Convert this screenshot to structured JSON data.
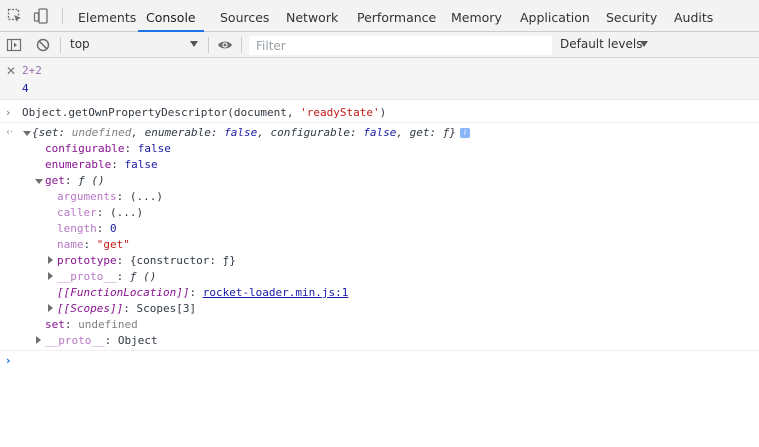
{
  "tabs": [
    {
      "label": "Elements"
    },
    {
      "label": "Console",
      "active": true
    },
    {
      "label": "Sources"
    },
    {
      "label": "Network"
    },
    {
      "label": "Performance"
    },
    {
      "label": "Memory"
    },
    {
      "label": "Application"
    },
    {
      "label": "Security"
    },
    {
      "label": "Audits"
    }
  ],
  "toolbar": {
    "context": "top",
    "filter_placeholder": "Filter",
    "levels": "Default levels"
  },
  "eager_eval": {
    "input": "2+2",
    "result": "4"
  },
  "command": {
    "prefix": "Object.getOwnPropertyDescriptor(document, ",
    "arg": "'readyState'",
    "suffix": ")"
  },
  "result": {
    "summary_open": "{",
    "summary_set_k": "set",
    "summary_set_v": "undefined",
    "summary_enum_k": "enumerable",
    "summary_enum_v": "false",
    "summary_conf_k": "configurable",
    "summary_conf_v": "false",
    "summary_get_k": "get",
    "summary_get_v": "ƒ",
    "summary_close": "}",
    "info_badge": "i",
    "configurable_k": "configurable",
    "configurable_v": "false",
    "enumerable_k": "enumerable",
    "enumerable_v": "false",
    "get_k": "get",
    "get_v": "ƒ ()",
    "arguments_k": "arguments",
    "arguments_v": "(...)",
    "caller_k": "caller",
    "caller_v": "(...)",
    "length_k": "length",
    "length_v": "0",
    "name_k": "name",
    "name_v": "\"get\"",
    "prototype_k": "prototype",
    "prototype_v": "{constructor: ƒ}",
    "proto_inner_k": "__proto__",
    "proto_inner_v": "ƒ ()",
    "function_location_k": "[[FunctionLocation]]",
    "function_location_v": "rocket-loader.min.js:1",
    "scopes_k": "[[Scopes]]",
    "scopes_v": "Scopes[3]",
    "set_k": "set",
    "set_v": "undefined",
    "proto_k": "__proto__",
    "proto_v": "Object"
  },
  "colors": {
    "accent": "#1a73e8",
    "key_purple": "#881391",
    "value_blue": "#1a1aa6",
    "string_red": "#c41a16"
  }
}
